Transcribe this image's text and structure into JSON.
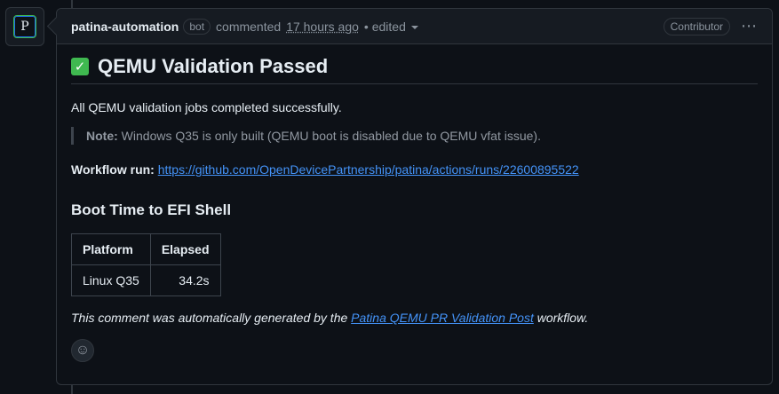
{
  "avatar": {
    "letter": "P"
  },
  "header": {
    "author": "patina-automation",
    "badge": "bot",
    "action": "commented",
    "time": "17 hours ago",
    "edited": "• edited",
    "role": "Contributor",
    "more_icon": "kebab-horizontal-icon"
  },
  "comment": {
    "title_icon": "white-check-mark-icon",
    "title": "QEMU Validation Passed",
    "intro": "All QEMU validation jobs completed successfully.",
    "note_label": "Note:",
    "note_text": " Windows Q35 is only built (QEMU boot is disabled due to QEMU vfat issue).",
    "workflow_label": "Workflow run:",
    "workflow_url": "https://github.com/OpenDevicePartnership/patina/actions/runs/22600895522",
    "section_title": "Boot Time to EFI Shell",
    "table": {
      "headers": [
        "Platform",
        "Elapsed"
      ],
      "rows": [
        [
          "Linux Q35",
          "34.2s"
        ]
      ]
    },
    "footer_prefix": "This comment was automatically generated by the ",
    "footer_link": "Patina QEMU PR Validation Post",
    "footer_suffix": " workflow.",
    "reaction_icon": "smiley-icon"
  }
}
